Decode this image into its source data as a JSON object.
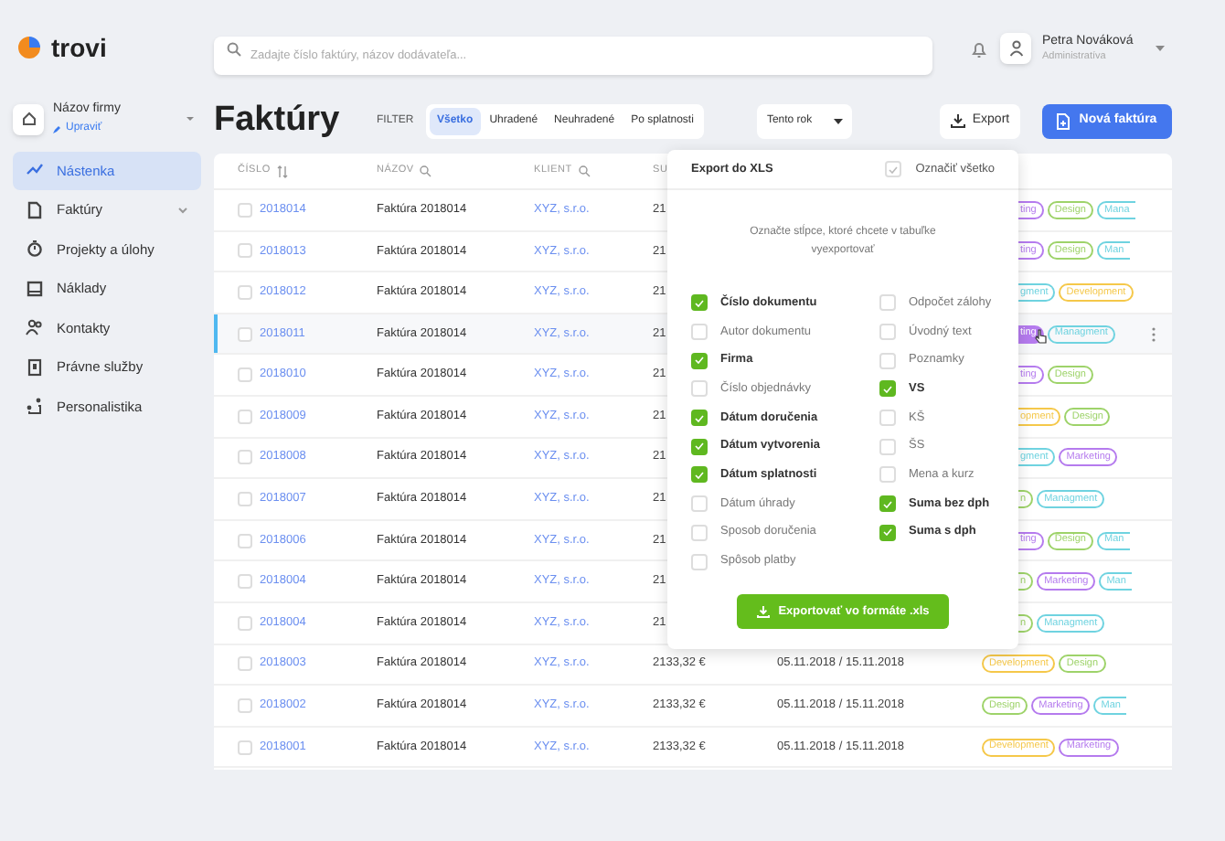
{
  "app": {
    "logo": "trovi"
  },
  "search": {
    "placeholder": "Zadajte číslo faktúry, názov dodávateľa..."
  },
  "user": {
    "name": "Petra Nováková",
    "role": "Administratíva"
  },
  "company": {
    "name": "Názov firmy",
    "edit": "Upraviť"
  },
  "sidebar": {
    "items": [
      {
        "label": "Nástenka",
        "selected": true,
        "expandable": false
      },
      {
        "label": "Faktúry",
        "selected": false,
        "expandable": true
      },
      {
        "label": "Projekty a úlohy",
        "selected": false,
        "expandable": false
      },
      {
        "label": "Náklady",
        "selected": false,
        "expandable": false
      },
      {
        "label": "Kontakty",
        "selected": false,
        "expandable": false
      },
      {
        "label": "Právne služby",
        "selected": false,
        "expandable": false
      },
      {
        "label": "Personalistika",
        "selected": false,
        "expandable": false
      }
    ]
  },
  "page": {
    "title": "Faktúry",
    "filter_label": "FILTER",
    "filters": [
      {
        "label": "Všetko",
        "selected": true
      },
      {
        "label": "Uhradené",
        "selected": false
      },
      {
        "label": "Neuhradené",
        "selected": false
      },
      {
        "label": "Po splatnosti",
        "selected": false
      }
    ],
    "period": "Tento rok",
    "export": "Export",
    "new_invoice": "Nová faktúra"
  },
  "table": {
    "columns": [
      {
        "label": "ČÍSLO"
      },
      {
        "label": "NÁZOV"
      },
      {
        "label": "KLIENT"
      },
      {
        "label": "SU"
      }
    ],
    "rows": [
      {
        "number": "2018014",
        "name": "Faktúra 2018014",
        "client": "XYZ, s.r.o.",
        "amount": "21",
        "checked": false,
        "selected": false,
        "tags": [
          {
            "label": "ting",
            "color": "#b57bee",
            "kind": "cut"
          },
          {
            "label": "Design",
            "color": "#9ed36a",
            "kind": "full"
          },
          {
            "label": "Mana",
            "color": "#6fd3e0",
            "kind": "faded"
          }
        ]
      },
      {
        "number": "2018013",
        "name": "Faktúra 2018014",
        "client": "XYZ, s.r.o.",
        "amount": "21",
        "checked": false,
        "selected": false,
        "tags": [
          {
            "label": "ting",
            "color": "#b57bee",
            "kind": "cut"
          },
          {
            "label": "Design",
            "color": "#9ed36a",
            "kind": "full"
          },
          {
            "label": "Man",
            "color": "#6fd3e0",
            "kind": "faded"
          }
        ]
      },
      {
        "number": "2018012",
        "name": "Faktúra 2018014",
        "client": "XYZ, s.r.o.",
        "amount": "21",
        "checked": false,
        "selected": false,
        "tags": [
          {
            "label": "gment",
            "color": "#6fd3e0",
            "kind": "cut"
          },
          {
            "label": "Development",
            "color": "#f5c84a",
            "kind": "full"
          }
        ]
      },
      {
        "number": "2018011",
        "name": "Faktúra 2018014",
        "client": "XYZ, s.r.o.",
        "amount": "21",
        "checked": false,
        "selected": true,
        "tags": [
          {
            "label": "ting",
            "color": "#b57bee",
            "kind": "hover"
          },
          {
            "label": "Managment",
            "color": "#6fd3e0",
            "kind": "full"
          }
        ]
      },
      {
        "number": "2018010",
        "name": "Faktúra 2018014",
        "client": "XYZ, s.r.o.",
        "amount": "21",
        "checked": false,
        "selected": false,
        "tags": [
          {
            "label": "ting",
            "color": "#b57bee",
            "kind": "cut"
          },
          {
            "label": "Design",
            "color": "#9ed36a",
            "kind": "full"
          }
        ]
      },
      {
        "number": "2018009",
        "name": "Faktúra 2018014",
        "client": "XYZ, s.r.o.",
        "amount": "21",
        "checked": false,
        "selected": false,
        "tags": [
          {
            "label": "opment",
            "color": "#f5c84a",
            "kind": "cut"
          },
          {
            "label": "Design",
            "color": "#9ed36a",
            "kind": "full"
          }
        ]
      },
      {
        "number": "2018008",
        "name": "Faktúra 2018014",
        "client": "XYZ, s.r.o.",
        "amount": "21",
        "checked": false,
        "selected": false,
        "tags": [
          {
            "label": "gment",
            "color": "#6fd3e0",
            "kind": "cut"
          },
          {
            "label": "Marketing",
            "color": "#b57bee",
            "kind": "full"
          }
        ]
      },
      {
        "number": "2018007",
        "name": "Faktúra 2018014",
        "client": "XYZ, s.r.o.",
        "amount": "21",
        "checked": false,
        "selected": false,
        "tags": [
          {
            "label": "n",
            "color": "#9ed36a",
            "kind": "cut"
          },
          {
            "label": "Managment",
            "color": "#6fd3e0",
            "kind": "full"
          }
        ]
      },
      {
        "number": "2018006",
        "name": "Faktúra 2018014",
        "client": "XYZ, s.r.o.",
        "amount": "21",
        "checked": false,
        "selected": false,
        "tags": [
          {
            "label": "ting",
            "color": "#b57bee",
            "kind": "cut"
          },
          {
            "label": "Design",
            "color": "#9ed36a",
            "kind": "full"
          },
          {
            "label": "Man",
            "color": "#6fd3e0",
            "kind": "faded"
          }
        ]
      },
      {
        "number": "2018004",
        "name": "Faktúra 2018014",
        "client": "XYZ, s.r.o.",
        "amount": "21",
        "checked": false,
        "selected": false,
        "tags": [
          {
            "label": "n",
            "color": "#9ed36a",
            "kind": "cut"
          },
          {
            "label": "Marketing",
            "color": "#b57bee",
            "kind": "full"
          },
          {
            "label": "Man",
            "color": "#6fd3e0",
            "kind": "faded"
          }
        ]
      },
      {
        "number": "2018004",
        "name": "Faktúra 2018014",
        "client": "XYZ, s.r.o.",
        "amount": "21",
        "checked": false,
        "selected": false,
        "tags": [
          {
            "label": "n",
            "color": "#9ed36a",
            "kind": "cut"
          },
          {
            "label": "Managment",
            "color": "#6fd3e0",
            "kind": "full"
          }
        ]
      },
      {
        "number": "2018003",
        "name": "Faktúra 2018014",
        "client": "XYZ, s.r.o.",
        "amount": "2133,32 €",
        "dates": "05.11.2018 / 15.11.2018",
        "checked": false,
        "selected": false,
        "tags": [
          {
            "label": "Development",
            "color": "#f5c84a",
            "kind": "full"
          },
          {
            "label": "Design",
            "color": "#9ed36a",
            "kind": "full"
          }
        ]
      },
      {
        "number": "2018002",
        "name": "Faktúra 2018014",
        "client": "XYZ, s.r.o.",
        "amount": "2133,32 €",
        "dates": "05.11.2018 / 15.11.2018",
        "checked": false,
        "selected": false,
        "tags": [
          {
            "label": "Design",
            "color": "#9ed36a",
            "kind": "full"
          },
          {
            "label": "Marketing",
            "color": "#b57bee",
            "kind": "full"
          },
          {
            "label": "Man",
            "color": "#6fd3e0",
            "kind": "faded"
          }
        ]
      },
      {
        "number": "2018001",
        "name": "Faktúra 2018014",
        "client": "XYZ, s.r.o.",
        "amount": "2133,32 €",
        "dates": "05.11.2018 / 15.11.2018",
        "checked": false,
        "selected": false,
        "tags": [
          {
            "label": "Development",
            "color": "#f5c84a",
            "kind": "full"
          },
          {
            "label": "Marketing",
            "color": "#b57bee",
            "kind": "full"
          }
        ]
      }
    ]
  },
  "export_popup": {
    "title": "Export do XLS",
    "select_all": {
      "label": "Označiť všetko",
      "checked": true
    },
    "hint": "Označte stĺpce, ktoré chcete v tabuľke vyexportovať",
    "columns": [
      {
        "options": [
          {
            "label": "Číslo dokumentu",
            "checked": true
          },
          {
            "label": "Autor dokumentu",
            "checked": false
          },
          {
            "label": "Firma",
            "checked": true
          },
          {
            "label": "Číslo objednávky",
            "checked": false
          },
          {
            "label": "Dátum doručenia",
            "checked": true
          },
          {
            "label": "Dátum vytvorenia",
            "checked": true
          },
          {
            "label": "Dátum splatnosti",
            "checked": true
          },
          {
            "label": "Dátum úhrady",
            "checked": false
          },
          {
            "label": "Sposob doručenia",
            "checked": false
          },
          {
            "label": "Spôsob platby",
            "checked": false
          }
        ]
      },
      {
        "options": [
          {
            "label": "Odpočet zálohy",
            "checked": false
          },
          {
            "label": "Úvodný text",
            "checked": false
          },
          {
            "label": "Poznamky",
            "checked": false
          },
          {
            "label": "VS",
            "checked": true
          },
          {
            "label": "KŠ",
            "checked": false
          },
          {
            "label": "ŠS",
            "checked": false
          },
          {
            "label": "Mena a kurz",
            "checked": false
          },
          {
            "label": "Suma bez dph",
            "checked": true
          },
          {
            "label": "Suma s dph",
            "checked": true
          }
        ]
      }
    ],
    "button": "Exportovať vo formáte .xls"
  }
}
